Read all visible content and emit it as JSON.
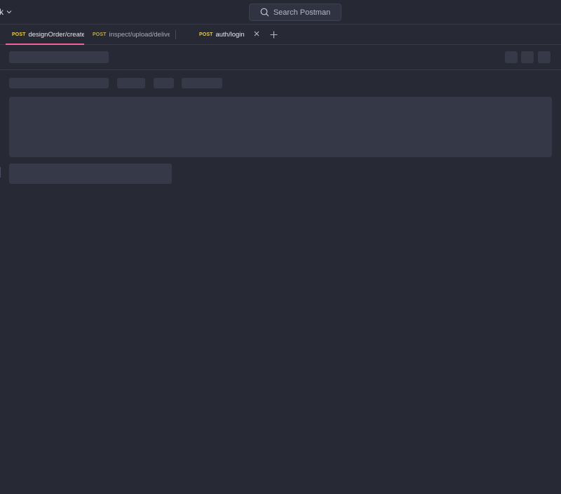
{
  "topbar": {
    "workspace_label": "k",
    "search_placeholder": "Search Postman"
  },
  "tabs": [
    {
      "method": "POST",
      "name": "designOrder/create",
      "active": true,
      "unsaved": true
    },
    {
      "method": "POST",
      "name": "inspect/upload/deliverI",
      "active": false,
      "unsaved": false
    },
    {
      "method": "POST",
      "name": "auth/login",
      "active": false,
      "unsaved": false
    }
  ],
  "colors": {
    "background": "#272935",
    "method_post": "#e8cb55",
    "active_tab_underline": "#f2639a",
    "unsaved_dot": "#f0609a",
    "skeleton": "#363947"
  },
  "icons": {
    "workspace_dropdown": "chevron-down-icon",
    "search": "search-icon",
    "close_tab": "close-icon",
    "new_tab": "plus-icon"
  },
  "state": {
    "loading": true
  }
}
